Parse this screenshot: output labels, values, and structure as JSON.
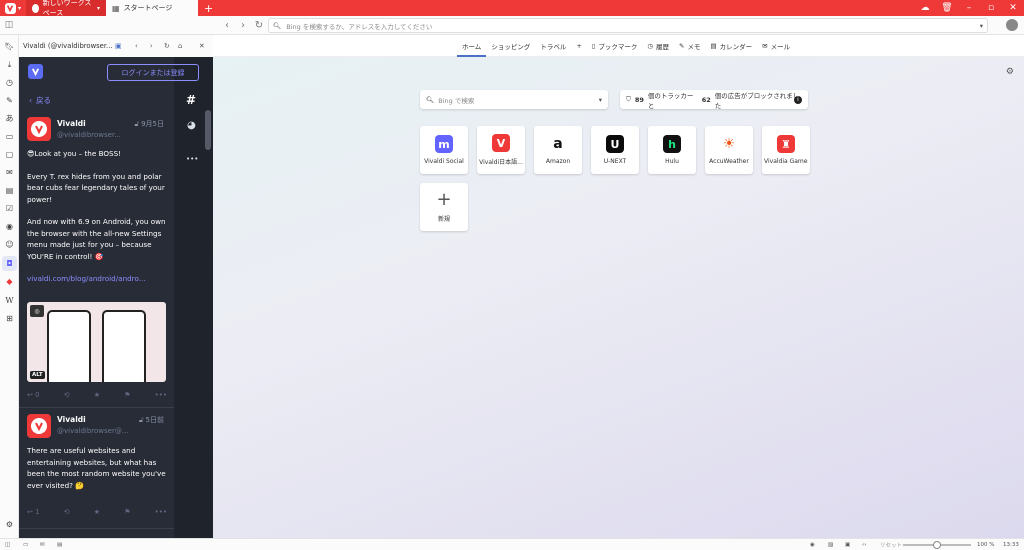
{
  "titlebar": {
    "workspace_tab": "新しいワークスペース",
    "start_tab": "スタートページ",
    "new_tab": "+"
  },
  "addressbar": {
    "placeholder": "Bing を検索するか、アドレスを入力してください"
  },
  "panel": {
    "title": "Vivaldi (@vivaldibrowser...",
    "login_button": "ログインまたは登録",
    "back_label": "戻る",
    "posts": [
      {
        "name": "Vivaldi",
        "handle": "@vivaldibrowser...",
        "date": "9月5日",
        "paragraphs": [
          "😎Look at you – the BOSS!",
          "Every T. rex hides from you and polar bear cubs fear legendary tales of your power!",
          "And now with 6.9 on Android, you own the browser with the all-new Settings menu made just for you – because YOU'RE in control! 🎯"
        ],
        "link": "vivaldi.com/blog/android/andro...",
        "alt_badge": "ALT",
        "reply_count": "0"
      },
      {
        "name": "Vivaldi",
        "handle": "@vivaldibrowser@...",
        "date": "5日前",
        "paragraphs": [
          "There are useful websites and entertaining websites, but what has been the most random website you've ever visited? 🤔"
        ],
        "reply_count": "1"
      }
    ]
  },
  "main": {
    "nav": [
      {
        "label": "ホーム",
        "icon": "",
        "active": true
      },
      {
        "label": "ショッピング",
        "icon": ""
      },
      {
        "label": "トラベル",
        "icon": ""
      },
      {
        "label": "+",
        "icon": ""
      },
      {
        "label": "ブックマーク",
        "icon": "bookmark-icon"
      },
      {
        "label": "履歴",
        "icon": "history-icon"
      },
      {
        "label": "メモ",
        "icon": "notes-icon"
      },
      {
        "label": "カレンダー",
        "icon": "calendar-icon"
      },
      {
        "label": "メール",
        "icon": "mail-icon"
      }
    ],
    "search_placeholder": "Bing で検索",
    "tracker_count": "89",
    "tracker_mid": "個のトラッカーと",
    "ads_count": "62",
    "tracker_tail": "個の広告がブロックされました",
    "speed_dials": [
      {
        "label": "Vivaldi Social",
        "icon": "mastodon-icon",
        "color": "#6364ff"
      },
      {
        "label": "Vivaldi日本語...",
        "icon": "vivaldi-icon",
        "color": "#ef3939"
      },
      {
        "label": "Amazon",
        "icon": "amazon-icon",
        "color": "#111111"
      },
      {
        "label": "U-NEXT",
        "icon": "unext-icon",
        "color": "#0b0b0b"
      },
      {
        "label": "Hulu",
        "icon": "hulu-icon",
        "color": "#1ce783"
      },
      {
        "label": "AccuWeather",
        "icon": "sun-icon",
        "color": "#f05514"
      },
      {
        "label": "Vivaldia Games",
        "icon": "games-icon",
        "color": "#ef3939"
      }
    ],
    "add_dial_label": "新規"
  },
  "statusbar": {
    "reset_label": "リセット",
    "zoom": "100 %",
    "time": "13:33",
    "zoom_level": 0.5
  }
}
